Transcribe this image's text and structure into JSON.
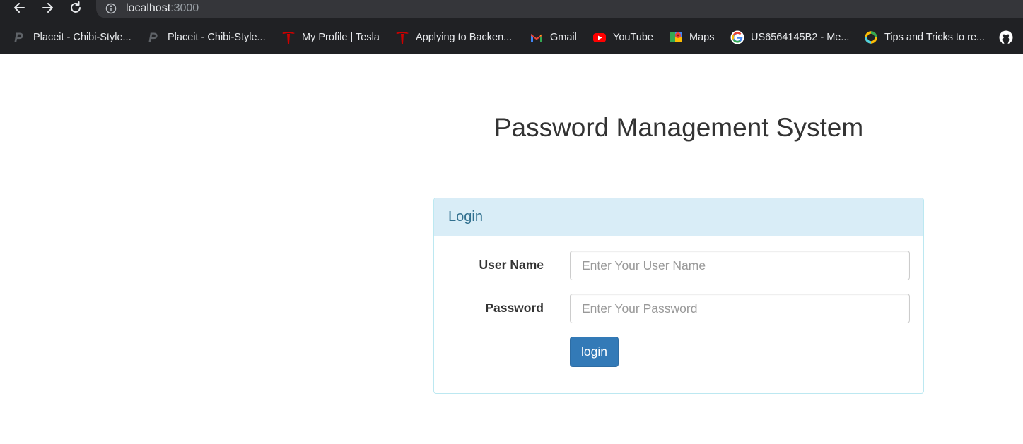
{
  "browser": {
    "url_host": "localhost",
    "url_port": ":3000",
    "bookmarks": [
      {
        "label": "Placeit - Chibi-Style...",
        "icon": "placeit-icon"
      },
      {
        "label": "Placeit - Chibi-Style...",
        "icon": "placeit-icon"
      },
      {
        "label": "My Profile | Tesla",
        "icon": "tesla-icon"
      },
      {
        "label": "Applying to Backen...",
        "icon": "tesla-icon"
      },
      {
        "label": "Gmail",
        "icon": "gmail-icon"
      },
      {
        "label": "YouTube",
        "icon": "youtube-icon"
      },
      {
        "label": "Maps",
        "icon": "maps-icon"
      },
      {
        "label": "US6564145B2 - Me...",
        "icon": "google-icon"
      },
      {
        "label": "Tips and Tricks to re...",
        "icon": "ring-icon"
      },
      {
        "label": "",
        "icon": "github-icon"
      }
    ]
  },
  "page": {
    "title": "Password Management System"
  },
  "login_panel": {
    "heading": "Login",
    "username_label": "User Name",
    "username_placeholder": "Enter Your User Name",
    "username_value": "",
    "password_label": "Password",
    "password_placeholder": "Enter Your Password",
    "password_value": "",
    "submit_label": "login"
  },
  "colors": {
    "browser_bg": "#202124",
    "omnibox_bg": "#35363a",
    "panel_heading_bg": "#d9edf7",
    "panel_border": "#bce8f1",
    "panel_heading_text": "#31708f",
    "primary_button": "#337ab7"
  }
}
